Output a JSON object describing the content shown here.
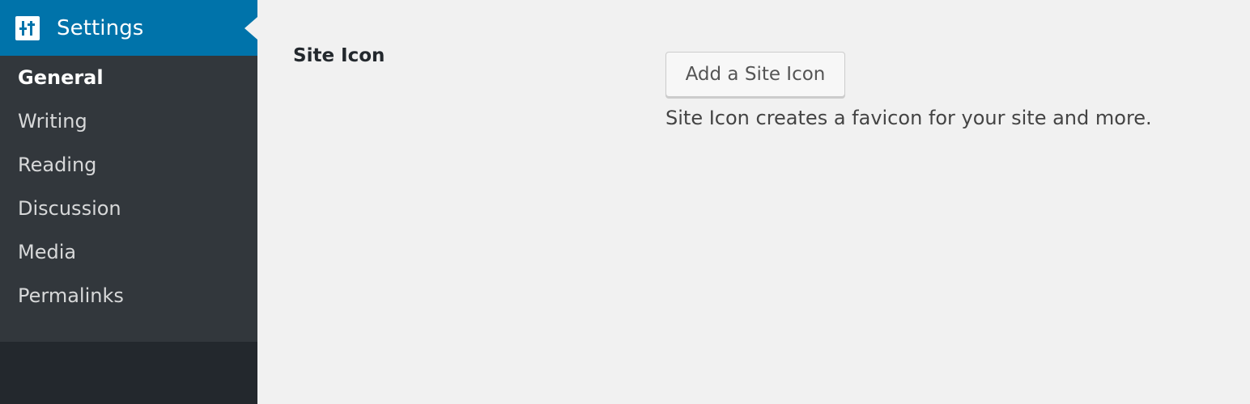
{
  "colors": {
    "sidebar_bg": "#23282d",
    "submenu_bg": "#32373c",
    "accent": "#0073aa",
    "content_bg": "#f1f1f1"
  },
  "sidebar": {
    "menu_title": "Settings",
    "menu_icon": "settings-icon",
    "items": [
      {
        "label": "General",
        "current": true
      },
      {
        "label": "Writing"
      },
      {
        "label": "Reading"
      },
      {
        "label": "Discussion"
      },
      {
        "label": "Media"
      },
      {
        "label": "Permalinks"
      }
    ]
  },
  "main": {
    "site_icon_field": {
      "label": "Site Icon",
      "button_label": "Add a Site Icon",
      "description": "Site Icon creates a favicon for your site and more."
    }
  }
}
